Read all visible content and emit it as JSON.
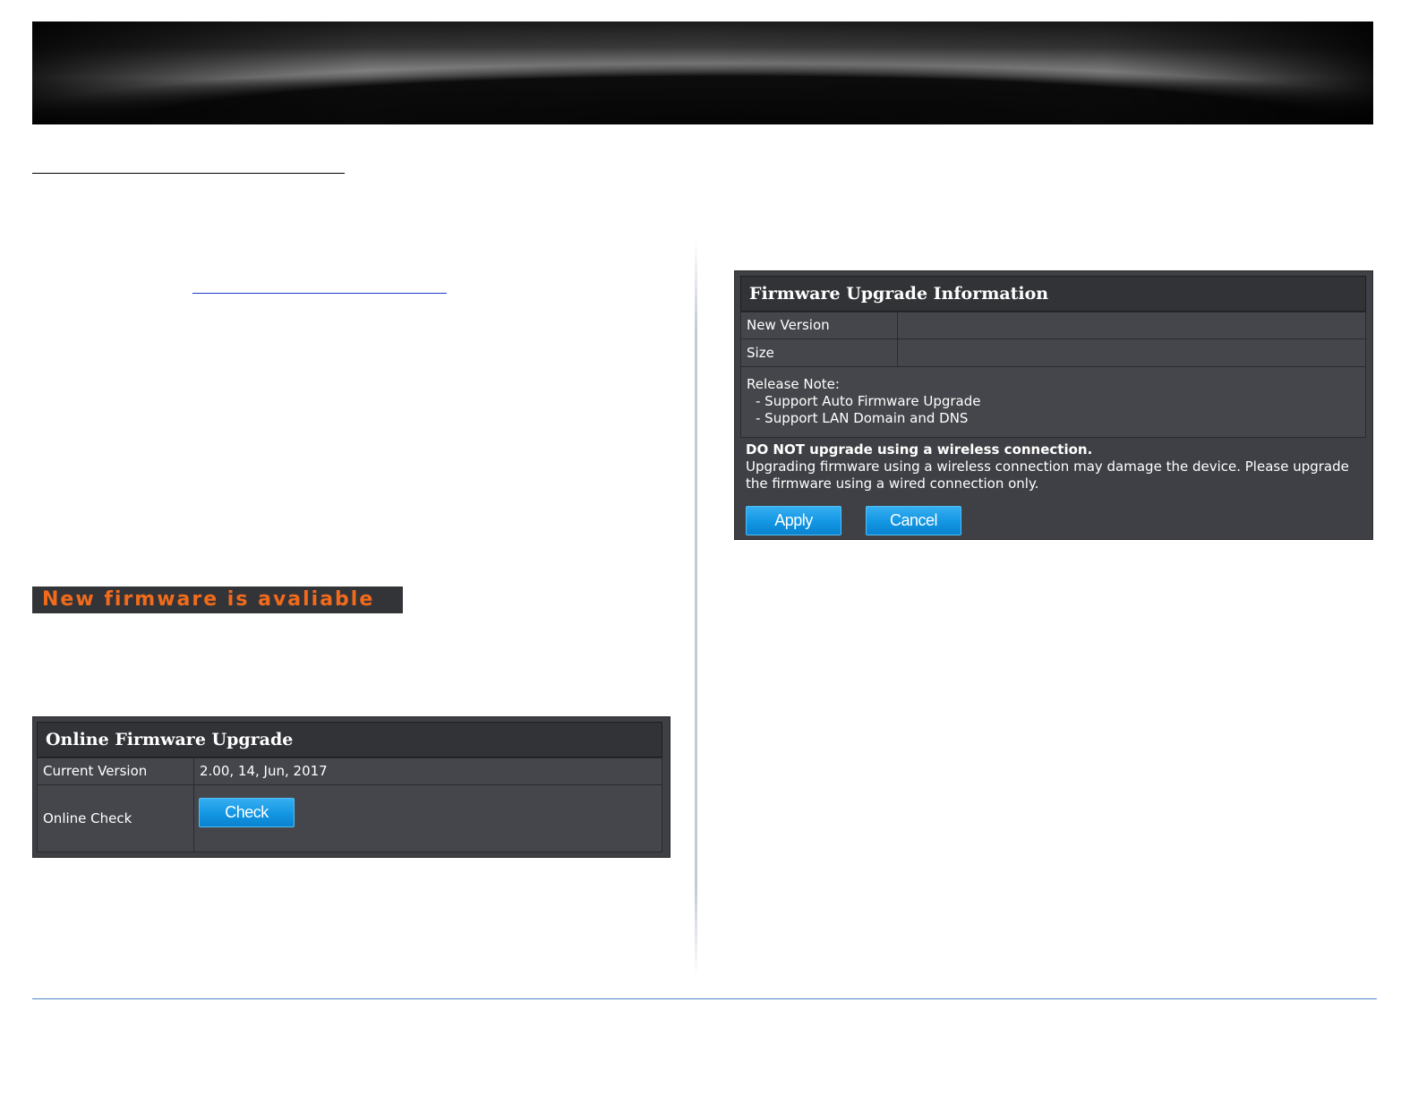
{
  "notice": {
    "text": "New firmware is avaliable"
  },
  "online_firmware_upgrade": {
    "title": "Online Firmware Upgrade",
    "current_version_label": "Current Version",
    "current_version_value": "2.00, 14, Jun, 2017",
    "online_check_label": "Online Check",
    "check_button": "Check"
  },
  "firmware_upgrade_info": {
    "title": "Firmware Upgrade Information",
    "new_version_label": "New Version",
    "new_version_value": "",
    "size_label": "Size",
    "size_value": "",
    "release_note_label": "Release Note:",
    "release_notes": [
      "- Support Auto Firmware Upgrade",
      "- Support LAN Domain and DNS"
    ],
    "warning_title": "DO NOT upgrade using a wireless connection.",
    "warning_text": "Upgrading firmware using a wireless connection may damage the device. Please upgrade the firmware using a wired connection only.",
    "apply_button": "Apply",
    "cancel_button": "Cancel"
  },
  "colors": {
    "panel_bg": "#3f4045",
    "button_blue": "#1296e3",
    "notice_orange": "#f26a1b",
    "footer_rule": "#4f87c8"
  }
}
